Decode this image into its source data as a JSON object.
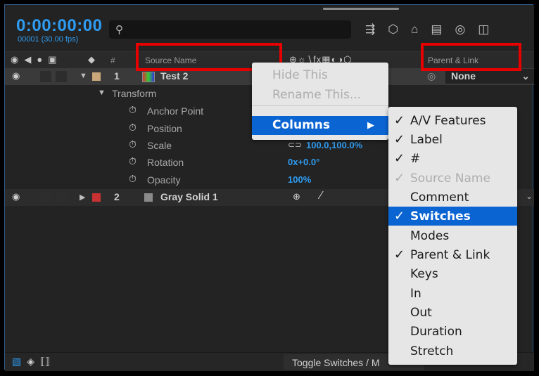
{
  "header": {
    "timecode": "0:00:00:00",
    "frame_rate": "00001 (30.00 fps)",
    "search_placeholder": ""
  },
  "columns": {
    "label_hash": "#",
    "source_name": "Source Name",
    "parent_link": "Parent & Link"
  },
  "layers": [
    {
      "num": "1",
      "name": "Test 2",
      "label_color": "#c8a87a",
      "parent": "None",
      "expanded": true
    },
    {
      "num": "2",
      "name": "Gray Solid 1",
      "label_color": "#c83232",
      "expanded": false
    }
  ],
  "transform": {
    "group": "Transform",
    "properties": [
      {
        "name": "Anchor Point",
        "value": ""
      },
      {
        "name": "Position",
        "value": ""
      },
      {
        "name": "Scale",
        "value": "100.0,100.0%"
      },
      {
        "name": "Rotation",
        "value": "0x+0.0°"
      },
      {
        "name": "Opacity",
        "value": "100%"
      }
    ]
  },
  "context_menu": {
    "hide_this": "Hide This",
    "rename_this": "Rename This...",
    "columns": "Columns"
  },
  "columns_submenu": [
    {
      "label": "A/V Features",
      "checked": true
    },
    {
      "label": "Label",
      "checked": true
    },
    {
      "label": "#",
      "checked": true
    },
    {
      "label": "Source Name",
      "checked": true,
      "disabled": true
    },
    {
      "label": "Comment",
      "checked": false
    },
    {
      "label": "Switches",
      "checked": true,
      "highlighted": true
    },
    {
      "label": "Modes",
      "checked": false
    },
    {
      "label": "Parent & Link",
      "checked": true
    },
    {
      "label": "Keys",
      "checked": false
    },
    {
      "label": "In",
      "checked": false
    },
    {
      "label": "Out",
      "checked": false
    },
    {
      "label": "Duration",
      "checked": false
    },
    {
      "label": "Stretch",
      "checked": false
    }
  ],
  "bottom": {
    "toggle_label": "Toggle Switches / M"
  },
  "colors": {
    "accent_blue": "#2e9cf2",
    "menu_highlight": "#0a64d2",
    "annotation_red": "#e60000"
  }
}
